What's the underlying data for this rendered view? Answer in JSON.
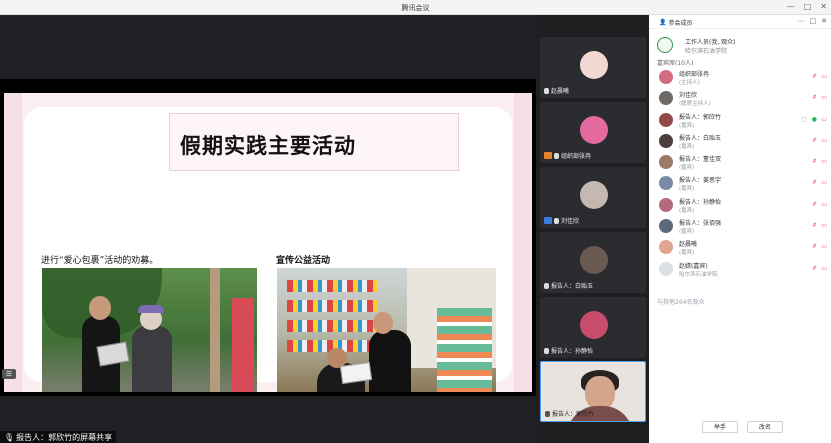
{
  "window": {
    "title": "腾讯会议"
  },
  "slide": {
    "title": "假期实践主要活动",
    "caption_left": "进行“爱心包裹”活动的劝募。",
    "caption_right": "宣传公益活动"
  },
  "share_status": "报告人：郭欣竹的屏幕共享",
  "tiles": [
    {
      "name": "赵晨曦",
      "avatar_color": "#f3d9d3"
    },
    {
      "name": "组织部张冉",
      "avatar_color": "#e46aa0",
      "badge_color": "#e8812c"
    },
    {
      "name": "刘佳欣",
      "avatar_color": "#c4b8b0",
      "badge_color": "#3d7be0"
    },
    {
      "name": "报告人：白贻玉",
      "avatar_color": "#6b5a52"
    },
    {
      "name": "报告人：孙静怡",
      "avatar_color": "#c84c6b"
    },
    {
      "name": "报告人：郭欣竹",
      "type": "video"
    }
  ],
  "panel": {
    "title": "参会成员",
    "host_name": "工作人员(我, 观众)",
    "host_org": "哈尔滨石油学院",
    "section_label": "嘉宾席(10人)",
    "members": [
      {
        "name": "组织部张冉",
        "role": "(主持人)",
        "avatar_color": "#d56b82"
      },
      {
        "name": "刘佳欣",
        "role": "(联席主持人)",
        "avatar_color": "#6e6a68"
      },
      {
        "name": "报告人：郭欣竹",
        "role": "(嘉宾)",
        "avatar_color": "#8f4a43",
        "mic_on": true
      },
      {
        "name": "报告人：白贻玉",
        "role": "(嘉宾)",
        "avatar_color": "#4a3f3a"
      },
      {
        "name": "报告人：董佳双",
        "role": "(嘉宾)",
        "avatar_color": "#9c7a68"
      },
      {
        "name": "报告人：姜思宇",
        "role": "(嘉宾)",
        "avatar_color": "#7a8aa6"
      },
      {
        "name": "报告人：孙静怡",
        "role": "(嘉宾)",
        "avatar_color": "#b46a7a"
      },
      {
        "name": "报告人：张佰强",
        "role": "(嘉宾)",
        "avatar_color": "#5a6a7a"
      },
      {
        "name": "赵晨曦",
        "role": "(嘉宾)",
        "avatar_color": "#e0a58e"
      },
      {
        "name": "赵婧(嘉宾)",
        "role": "哈尔滨石油学院",
        "avatar_color": "#dcdfe4"
      }
    ],
    "more_text": "与其他264名观众",
    "btn_raise": "举手",
    "btn_rename": "改名"
  }
}
